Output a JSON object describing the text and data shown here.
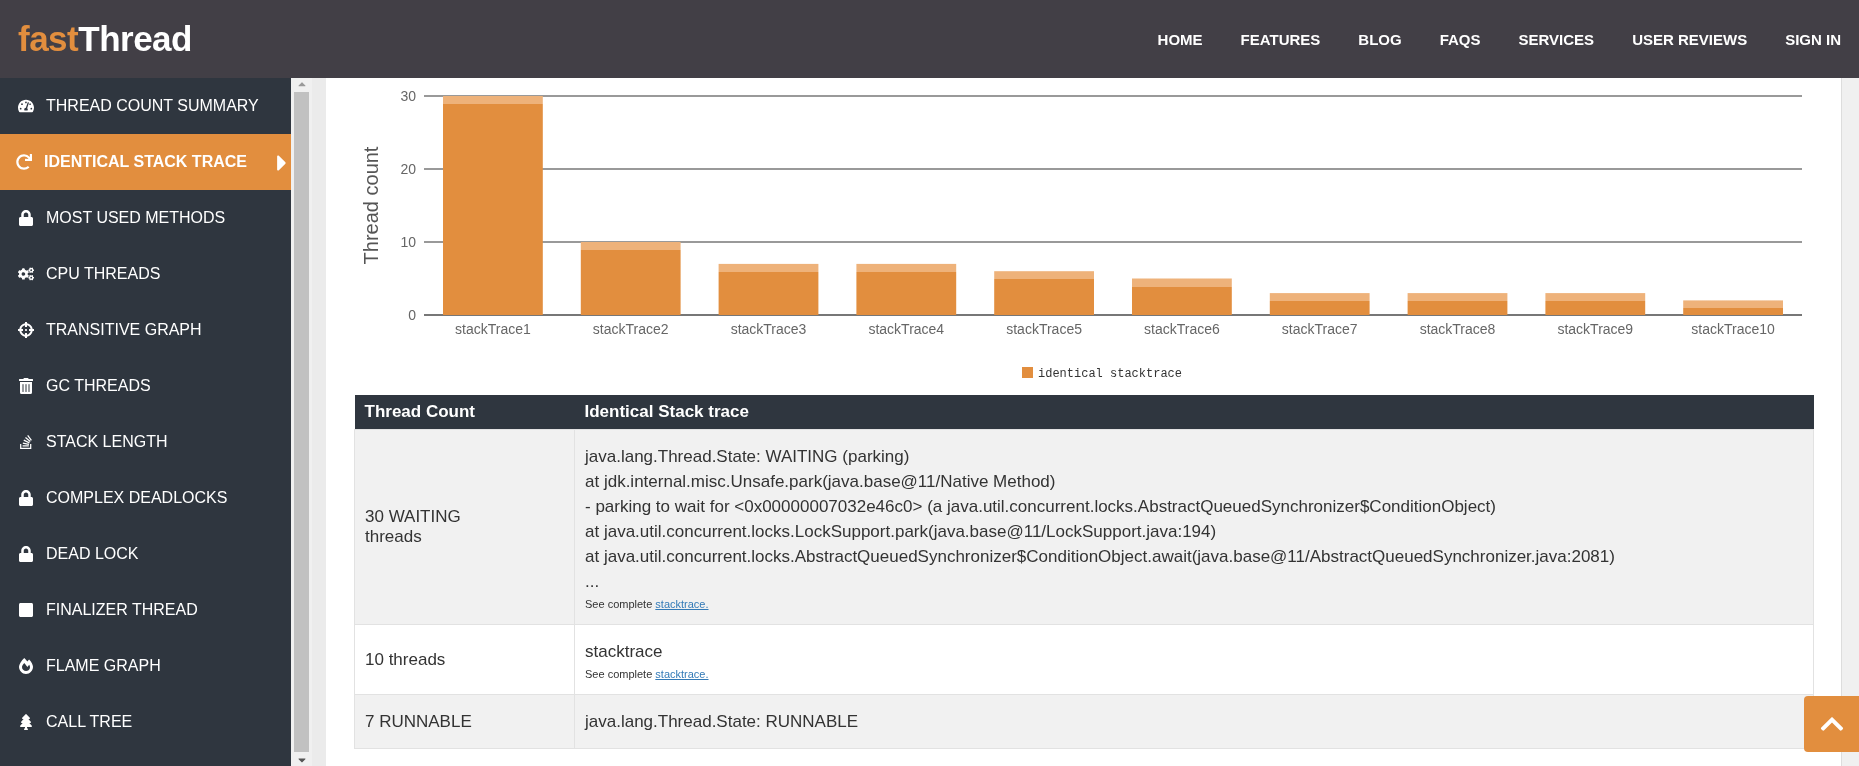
{
  "header": {
    "logo": {
      "prefix": "fast",
      "suffix": "Thread"
    },
    "nav": [
      "HOME",
      "FEATURES",
      "BLOG",
      "FAQS",
      "SERVICES",
      "USER REVIEWS",
      "SIGN IN"
    ]
  },
  "sidebar": {
    "items": [
      {
        "label": "THREAD COUNT SUMMARY",
        "selected": false
      },
      {
        "label": "IDENTICAL STACK TRACE",
        "selected": true
      },
      {
        "label": "MOST USED METHODS",
        "selected": false
      },
      {
        "label": "CPU THREADS",
        "selected": false
      },
      {
        "label": "TRANSITIVE GRAPH",
        "selected": false
      },
      {
        "label": "GC THREADS",
        "selected": false
      },
      {
        "label": "STACK LENGTH",
        "selected": false
      },
      {
        "label": "COMPLEX DEADLOCKS",
        "selected": false
      },
      {
        "label": "DEAD LOCK",
        "selected": false
      },
      {
        "label": "FINALIZER THREAD",
        "selected": false
      },
      {
        "label": "FLAME GRAPH",
        "selected": false
      },
      {
        "label": "CALL TREE",
        "selected": false
      }
    ]
  },
  "chart": {
    "chart_data": {
      "type": "bar",
      "ylabel": "Thread count",
      "categories": [
        "stackTrace1",
        "stackTrace2",
        "stackTrace3",
        "stackTrace4",
        "stackTrace5",
        "stackTrace6",
        "stackTrace7",
        "stackTrace8",
        "stackTrace9",
        "stackTrace10"
      ],
      "series": [
        {
          "name": "identical stacktrace",
          "color": "#e28e3e",
          "values": [
            30,
            10,
            7,
            7,
            6,
            5,
            3,
            3,
            3,
            2
          ]
        }
      ],
      "ylim": [
        0,
        30
      ],
      "yticks": [
        0,
        10,
        20,
        30
      ]
    }
  },
  "table": {
    "columns": [
      "Thread Count",
      "Identical Stack trace"
    ],
    "rows": [
      {
        "count": "30 WAITING threads",
        "lines": [
          "java.lang.Thread.State: WAITING (parking)",
          "at jdk.internal.misc.Unsafe.park(java.base@11/Native Method)",
          "- parking to wait for <0x00000007032e46c0> (a java.util.concurrent.locks.AbstractQueuedSynchronizer$ConditionObject)",
          "at java.util.concurrent.locks.LockSupport.park(java.base@11/LockSupport.java:194)",
          "at java.util.concurrent.locks.AbstractQueuedSynchronizer$ConditionObject.await(java.base@11/AbstractQueuedSynchronizer.java:2081)",
          "..."
        ],
        "note": "See complete",
        "link": "stacktrace."
      },
      {
        "count": "10 threads",
        "lines": [
          "stacktrace"
        ],
        "note": "See complete",
        "link": "stacktrace."
      },
      {
        "count": "7 RUNNABLE",
        "lines": [
          "java.lang.Thread.State: RUNNABLE"
        ]
      }
    ]
  }
}
